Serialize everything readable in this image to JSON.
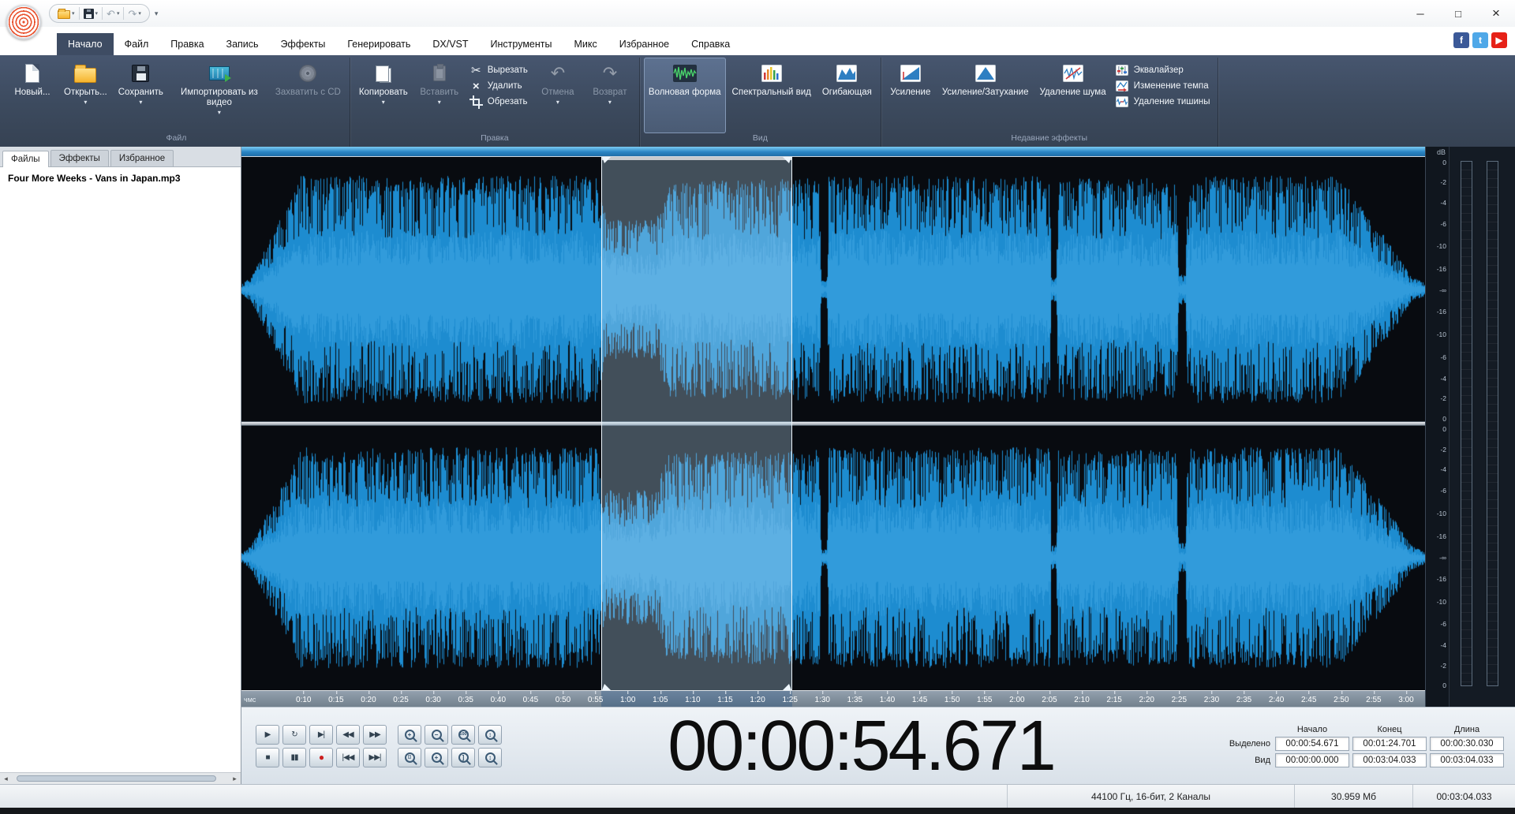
{
  "titlebar": {
    "window_controls": {
      "minimize": "─",
      "maximize": "□",
      "close": "×"
    }
  },
  "menu": {
    "tabs": [
      "Начало",
      "Файл",
      "Правка",
      "Запись",
      "Эффекты",
      "Генерировать",
      "DX/VST",
      "Инструменты",
      "Микс",
      "Избранное",
      "Справка"
    ],
    "active_tab": "Начало",
    "social": [
      {
        "name": "facebook",
        "glyph": "f",
        "color": "#3b5998"
      },
      {
        "name": "twitter",
        "glyph": "t",
        "color": "#4fa8e8"
      },
      {
        "name": "youtube",
        "glyph": "▶",
        "color": "#e62117"
      }
    ]
  },
  "ribbon": {
    "groups": [
      {
        "title": "Файл",
        "items": [
          {
            "type": "big",
            "label": "Новый...",
            "icon": "new"
          },
          {
            "type": "big",
            "label": "Открыть...",
            "icon": "open",
            "dropdown": true
          },
          {
            "type": "big",
            "label": "Сохранить",
            "icon": "save",
            "dropdown": true
          },
          {
            "type": "big",
            "label": "Импортировать из видео",
            "icon": "video",
            "dropdown": true
          },
          {
            "type": "big",
            "label": "Захватить с CD",
            "icon": "cd",
            "disabled": true
          }
        ]
      },
      {
        "title": "Правка",
        "items": [
          {
            "type": "big",
            "label": "Копировать",
            "icon": "copy",
            "dropdown": true
          },
          {
            "type": "big",
            "label": "Вставить",
            "icon": "paste",
            "dropdown": true,
            "disabled": true
          },
          {
            "type": "stack",
            "buttons": [
              {
                "label": "Вырезать",
                "icon": "cut"
              },
              {
                "label": "Удалить",
                "icon": "delete"
              },
              {
                "label": "Обрезать",
                "icon": "crop"
              }
            ]
          },
          {
            "type": "big",
            "label": "Отмена",
            "icon": "undo",
            "dropdown": true,
            "disabled": true
          },
          {
            "type": "big",
            "label": "Возврат",
            "icon": "redo",
            "dropdown": true,
            "disabled": true
          }
        ]
      },
      {
        "title": "Вид",
        "items": [
          {
            "type": "big",
            "label": "Волновая форма",
            "icon": "waveform",
            "selected": true
          },
          {
            "type": "big",
            "label": "Спектральный вид",
            "icon": "spectral"
          },
          {
            "type": "big",
            "label": "Огибающая",
            "icon": "envelope"
          }
        ]
      },
      {
        "title": "Недавние эффекты",
        "items": [
          {
            "type": "big",
            "label": "Усиление",
            "icon": "amplify"
          },
          {
            "type": "big",
            "label": "Усиление/Затухание",
            "icon": "fade"
          },
          {
            "type": "big",
            "label": "Удаление шума",
            "icon": "noise"
          },
          {
            "type": "stack",
            "buttons": [
              {
                "label": "Эквалайзер",
                "icon": "equalizer"
              },
              {
                "label": "Изменение темпа",
                "icon": "tempo"
              },
              {
                "label": "Удаление тишины",
                "icon": "silence"
              }
            ]
          }
        ]
      }
    ]
  },
  "sidebar": {
    "tabs": [
      "Файлы",
      "Эффекты",
      "Избранное"
    ],
    "active_tab": "Файлы",
    "files": [
      "Four More Weeks - Vans in Japan.mp3"
    ]
  },
  "waveform": {
    "db_title": "dB",
    "db_labels": [
      "0",
      "-2",
      "-4",
      "-6",
      "-10",
      "-16",
      "-∞",
      "-16",
      "-10",
      "-6",
      "-4",
      "-2",
      "0"
    ],
    "timeline_unit": "чмс",
    "timeline_labels": [
      "0:10",
      "0:15",
      "0:20",
      "0:25",
      "0:30",
      "0:35",
      "0:40",
      "0:45",
      "0:50",
      "0:55",
      "1:00",
      "1:05",
      "1:10",
      "1:15",
      "1:20",
      "1:25",
      "1:30",
      "1:35",
      "1:40",
      "1:45",
      "1:50",
      "1:55",
      "2:00",
      "2:05",
      "2:10",
      "2:15",
      "2:20",
      "2:25",
      "2:30",
      "2:35",
      "2:40",
      "2:45",
      "2:50",
      "2:55",
      "3:00"
    ],
    "accent_color": "#1d8cd0"
  },
  "transport": {
    "rows": [
      [
        {
          "name": "play",
          "glyph": "▶"
        },
        {
          "name": "play-loop",
          "glyph": "↻"
        },
        {
          "name": "play-selection",
          "glyph": "▶|"
        },
        {
          "name": "rewind",
          "glyph": "◀◀"
        },
        {
          "name": "fast-forward",
          "glyph": "▶▶"
        }
      ],
      [
        {
          "name": "stop",
          "glyph": "■"
        },
        {
          "name": "pause",
          "glyph": "▮▮"
        },
        {
          "name": "record",
          "glyph": "●",
          "accent": "#cc2020"
        },
        {
          "name": "go-to-start",
          "glyph": "|◀◀"
        },
        {
          "name": "go-to-end",
          "glyph": "▶▶|"
        }
      ]
    ]
  },
  "zoom": {
    "rows": [
      [
        {
          "name": "zoom-in",
          "inner": "+"
        },
        {
          "name": "zoom-out",
          "inner": "−"
        },
        {
          "name": "zoom-100",
          "inner": "100"
        },
        {
          "name": "zoom-vertical-in",
          "inner": "↕"
        }
      ],
      [
        {
          "name": "zoom-to-selection",
          "inner": "[]"
        },
        {
          "name": "zoom-in-alt",
          "inner": "+"
        },
        {
          "name": "zoom-out-alt",
          "inner": "]"
        },
        {
          "name": "zoom-vertical-out",
          "inner": "↕"
        }
      ]
    ]
  },
  "time_display": "00:00:54.671",
  "selection_panel": {
    "columns": [
      "Начало",
      "Конец",
      "Длина"
    ],
    "rows": [
      {
        "label": "Выделено",
        "values": [
          "00:00:54.671",
          "00:01:24.701",
          "00:00:30.030"
        ]
      },
      {
        "label": "Вид",
        "values": [
          "00:00:00.000",
          "00:03:04.033",
          "00:03:04.033"
        ]
      }
    ]
  },
  "statusbar": {
    "items": [
      "44100 Гц, 16-бит, 2 Каналы",
      "30.959 Мб",
      "00:03:04.033"
    ]
  }
}
